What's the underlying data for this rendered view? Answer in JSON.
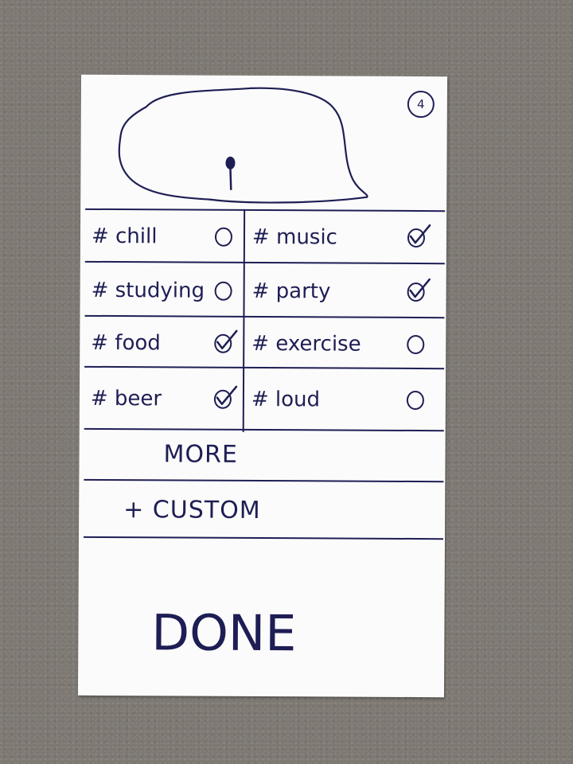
{
  "screen": {
    "page_number": "4"
  },
  "map": {
    "icon": "map-pin-icon"
  },
  "tags": [
    {
      "label": "# chill",
      "checked": false
    },
    {
      "label": "# music",
      "checked": true
    },
    {
      "label": "# studying",
      "checked": false
    },
    {
      "label": "# party",
      "checked": true
    },
    {
      "label": "# food",
      "checked": true
    },
    {
      "label": "# exercise",
      "checked": false
    },
    {
      "label": "# beer",
      "checked": true
    },
    {
      "label": "# loud",
      "checked": false
    }
  ],
  "actions": {
    "more_label": "MORE",
    "custom_label": "+ CUSTOM"
  },
  "footer": {
    "done_label": "DONE"
  },
  "colors": {
    "ink": "#1e1e55",
    "paper": "#fbfbfb",
    "background": "#7d7872"
  }
}
